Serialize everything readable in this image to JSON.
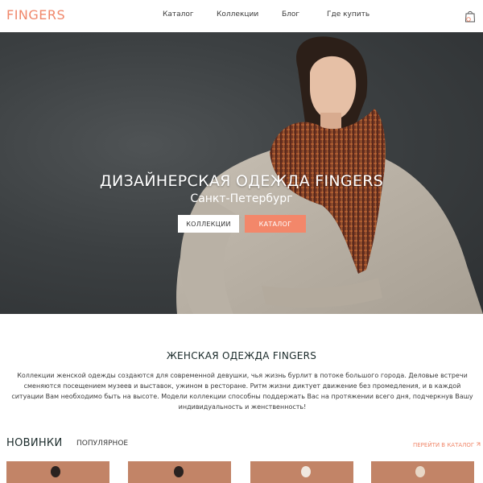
{
  "header": {
    "logo": "FINGERS",
    "nav": [
      "Каталог",
      "Коллекции",
      "Блог",
      "Где купить"
    ],
    "cart_icon": "shopping-bag-icon"
  },
  "hero": {
    "title": "ДИЗАЙНЕРСКАЯ ОДЕЖДА FINGERS",
    "subtitle": "Санкт-Петербург",
    "button_collections": "КОЛЛЕКЦИИ",
    "button_catalog": "КАТАЛОГ"
  },
  "about": {
    "title": "ЖЕНСКАЯ ОДЕЖДА FINGERS",
    "text": "Коллекции женской одежды создаются для современной девушки, чья жизнь бурлит в потоке большого города. Деловые встречи сменяются посещением музеев и выставок, ужином в ресторане. Ритм жизни диктует движение без промедления, и в каждой ситуации Вам необходимо быть на высоте. Модели коллекции способны поддержать Вас на протяжении всего дня, подчеркнув Вашу индивидуальность и женственность!"
  },
  "products": {
    "tab_new": "НОВИНКИ",
    "tab_popular": "ПОПУЛЯРНОЕ",
    "catalog_link": "ПЕРЕЙТИ В КАТАЛОГ"
  },
  "colors": {
    "accent": "#f3876a",
    "hero_bg": "#3c4042",
    "card_bg": "#c28467"
  }
}
